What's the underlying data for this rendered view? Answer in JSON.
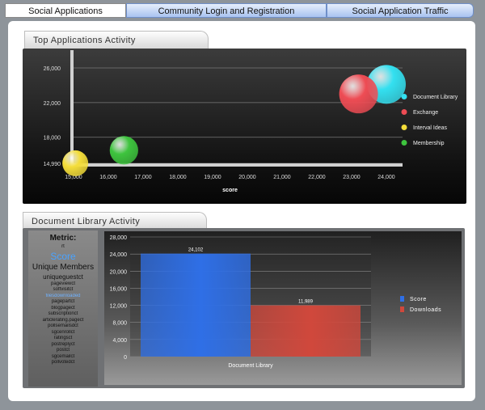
{
  "tabs": [
    {
      "label": "Social Applications",
      "active": true
    },
    {
      "label": "Community Login and Registration",
      "active": false
    },
    {
      "label": "Social Application Traffic",
      "active": false
    }
  ],
  "top_section": {
    "title": "Top Applications Activity"
  },
  "bottom_section": {
    "title": "Document Library Activity"
  },
  "metric_panel": {
    "title": "Metric:",
    "items": [
      "rt",
      "Score",
      "Unique Members",
      "uniqueguestct",
      "pageviewct",
      "softvisitct",
      "filesdownloaded",
      "pagepartct",
      "blogpagect",
      "subscriptionct",
      "articlerating.pagect",
      "pollsemailsdct",
      "sgcenrollct",
      "ratingsct",
      "postreplyct",
      "postct",
      "sgcemailct",
      "pollvotedct"
    ],
    "highlight_item": "filesdownloaded"
  },
  "chart_data": [
    {
      "type": "scatter",
      "title": "",
      "xlabel": "score",
      "ylabel": "",
      "xlim": [
        15000,
        24000
      ],
      "ylim": [
        14990,
        26000
      ],
      "x_ticks": [
        "15,000",
        "16,000",
        "17,000",
        "18,000",
        "19,000",
        "20,000",
        "21,000",
        "22,000",
        "23,000",
        "24,000"
      ],
      "y_ticks": [
        "14,990",
        "18,000",
        "22,000",
        "26,000"
      ],
      "legend_position": "right",
      "grid": true,
      "series": [
        {
          "name": "Document Library",
          "color": "#33e0f0",
          "x": 24000,
          "y": 24100,
          "size": 3.0
        },
        {
          "name": "Exchange",
          "color": "#ee4c54",
          "x": 23200,
          "y": 23000,
          "size": 3.0
        },
        {
          "name": "Interval Ideas",
          "color": "#f4dd3a",
          "x": 15050,
          "y": 15000,
          "size": 2.0
        },
        {
          "name": "Membership",
          "color": "#3ec43e",
          "x": 16450,
          "y": 16500,
          "size": 2.2
        }
      ]
    },
    {
      "type": "bar",
      "title": "",
      "xlabel": "",
      "ylabel": "",
      "categories": [
        "Document Library"
      ],
      "ylim": [
        0,
        28000
      ],
      "y_ticks": [
        "0",
        "4,000",
        "8,000",
        "12,000",
        "16,000",
        "20,000",
        "24,000",
        "28,000"
      ],
      "legend_position": "right",
      "grid": true,
      "series": [
        {
          "name": "Score",
          "color": "#2f6fe6",
          "values": [
            24102
          ],
          "label": "24,102"
        },
        {
          "name": "Downloads",
          "color": "#d0483c",
          "values": [
            11989
          ],
          "label": "11,989"
        }
      ]
    }
  ]
}
